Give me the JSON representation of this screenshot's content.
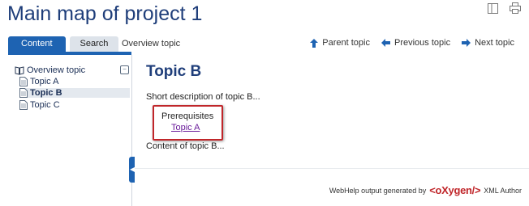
{
  "header": {
    "title": "Main map of project 1",
    "toggle_icon": "toc-toggle-icon",
    "print_icon": "print-icon"
  },
  "tabs": [
    {
      "label": "Content",
      "active": true
    },
    {
      "label": "Search",
      "active": false
    }
  ],
  "breadcrumb": "Overview topic",
  "nav": {
    "parent": "Parent topic",
    "previous": "Previous topic",
    "next": "Next topic"
  },
  "toc": {
    "root": "Overview topic",
    "items": [
      "Topic A",
      "Topic B",
      "Topic C"
    ],
    "selected": "Topic B"
  },
  "topic": {
    "title": "Topic B",
    "shortdesc": "Short description of topic B...",
    "prereq_label": "Prerequisites",
    "prereq_link": "Topic A",
    "body": "Content of topic B..."
  },
  "footer": {
    "prefix": "WebHelp output generated by",
    "brand": "<oXygen/>",
    "suffix": "XML Author"
  },
  "colors": {
    "accent": "#1e63b2",
    "title": "#1f3e7a",
    "highlight_border": "#c0262a"
  }
}
